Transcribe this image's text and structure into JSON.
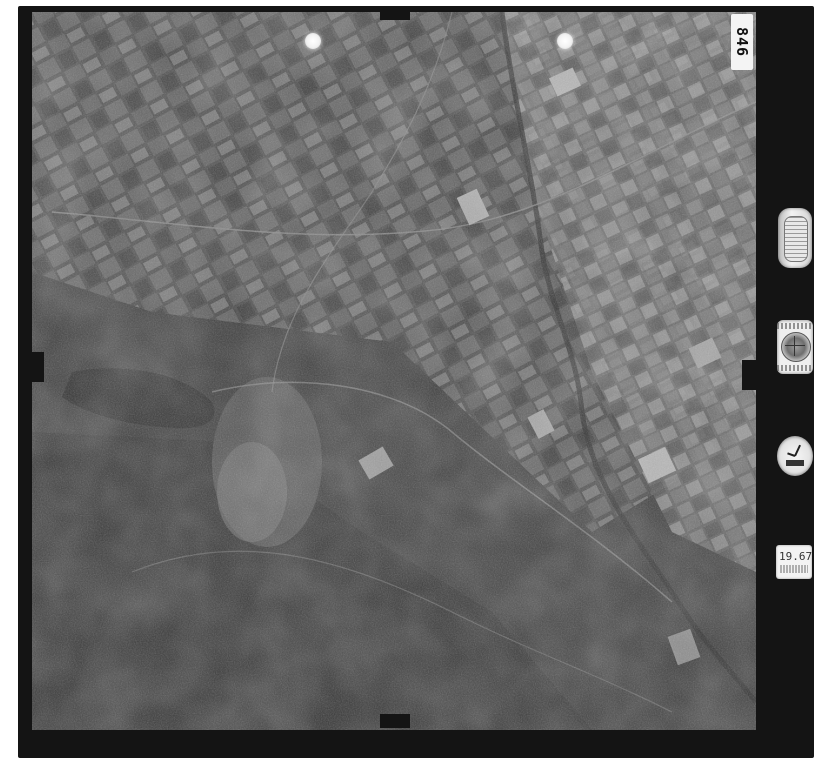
{
  "photo": {
    "frame_number": "846",
    "date_label": "19.67"
  },
  "colors": {
    "film_border": "#141414",
    "background": "#ffffff",
    "label_paper": "#f3f3f3"
  },
  "icons": {
    "altimeter": "altimeter-icon",
    "level_bubble": "level-bubble-icon",
    "clock": "clock-icon"
  }
}
